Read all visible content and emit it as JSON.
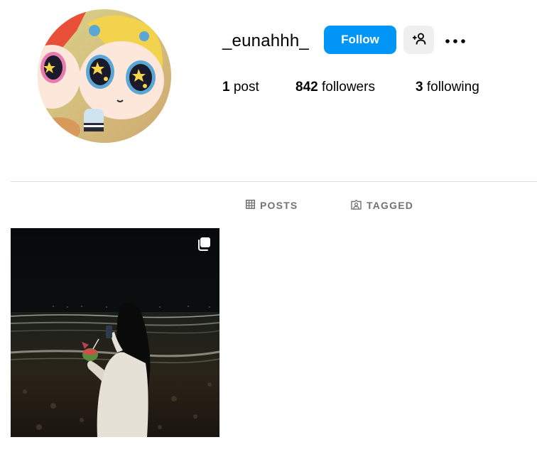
{
  "profile": {
    "username": "_eunahhh_",
    "follow_label": "Follow",
    "suggest_icon": "person-plus-icon",
    "more_icon": "more-horizontal-icon"
  },
  "stats": {
    "posts_count": "1",
    "posts_label": "post",
    "followers_count": "842",
    "followers_label": "followers",
    "following_count": "3",
    "following_label": "following"
  },
  "tabs": [
    {
      "label": "POSTS",
      "icon": "grid-icon"
    },
    {
      "label": "TAGGED",
      "icon": "tagged-icon"
    }
  ],
  "posts": [
    {
      "type": "carousel",
      "badge_icon": "carousel-icon"
    }
  ],
  "colors": {
    "accent": "#0095f6",
    "secondary_button": "#efefef",
    "muted_text": "#737373",
    "divider": "#dbdbdb"
  }
}
